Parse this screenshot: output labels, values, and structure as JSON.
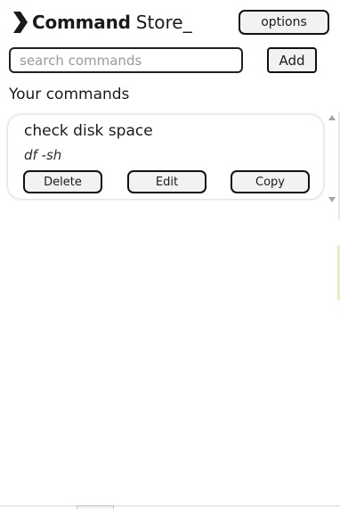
{
  "header": {
    "brand_bold": "Command",
    "brand_light": "Store_",
    "logo_icon": "chevron-right-icon",
    "options_label": "options"
  },
  "search": {
    "placeholder": "search commands",
    "value": "",
    "add_label": "Add"
  },
  "section": {
    "title": "Your commands"
  },
  "commands": [
    {
      "title": "check disk space",
      "command": "df -sh",
      "delete_label": "Delete",
      "edit_label": "Edit",
      "copy_label": "Copy"
    }
  ],
  "colors": {
    "button_bg": "#f2f2f2",
    "border": "#111111",
    "placeholder": "#9a9a9a",
    "edge_accent": "#e9eec0"
  }
}
